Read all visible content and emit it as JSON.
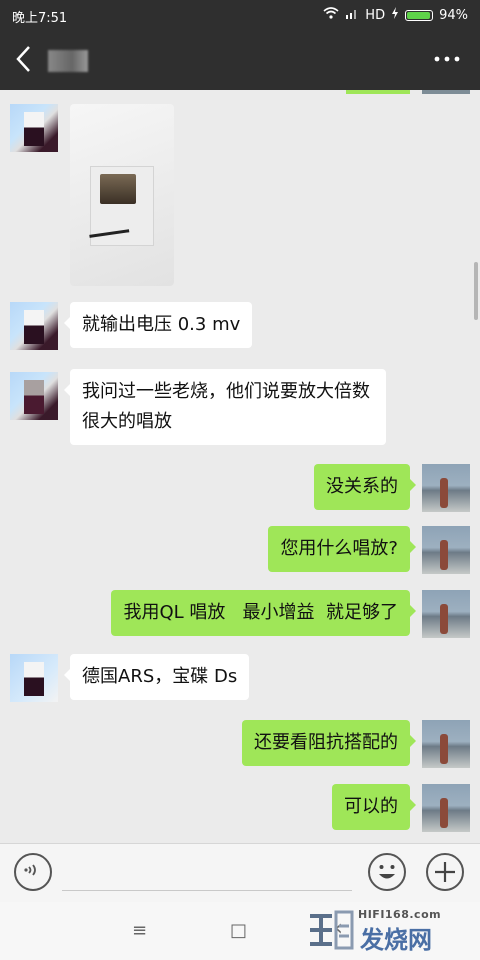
{
  "status_bar": {
    "time": "晚上7:51",
    "network": "HD",
    "battery": "94%",
    "battery_level": 0.94
  },
  "header": {
    "back_icon": "chevron-left-icon",
    "more_icon": "more-dots-icon"
  },
  "messages": [
    {
      "side": "left",
      "type": "image",
      "description_icon": "photo-message"
    },
    {
      "side": "left",
      "type": "text",
      "text": "就输出电压 0.3 mv"
    },
    {
      "side": "left",
      "type": "text",
      "text": "我问过一些老烧，他们说要放大倍数很大的唱放"
    },
    {
      "side": "right",
      "type": "text",
      "text": "没关系的"
    },
    {
      "side": "right",
      "type": "text",
      "text": "您用什么唱放?"
    },
    {
      "side": "right",
      "type": "text",
      "text": "我用QL 唱放   最小增益  就足够了"
    },
    {
      "side": "left",
      "type": "text",
      "text": "德国ARS，宝碟 Ds"
    },
    {
      "side": "right",
      "type": "text",
      "text": "还要看阻抗搭配的"
    },
    {
      "side": "right",
      "type": "text",
      "text": "可以的"
    }
  ],
  "input_bar": {
    "voice_icon": "voice-icon",
    "emoji_icon": "emoji-icon",
    "plus_icon": "plus-icon"
  },
  "nav_bar": {
    "menu_glyph": "≡",
    "home_glyph": "□",
    "back_glyph": "‹"
  },
  "watermark": {
    "site": "HIFI168.com",
    "name": "发烧网"
  },
  "colors": {
    "header_bg": "#2f2f2f",
    "chat_bg": "#ebebeb",
    "outgoing_bubble": "#9fe658",
    "incoming_bubble": "#ffffff"
  }
}
